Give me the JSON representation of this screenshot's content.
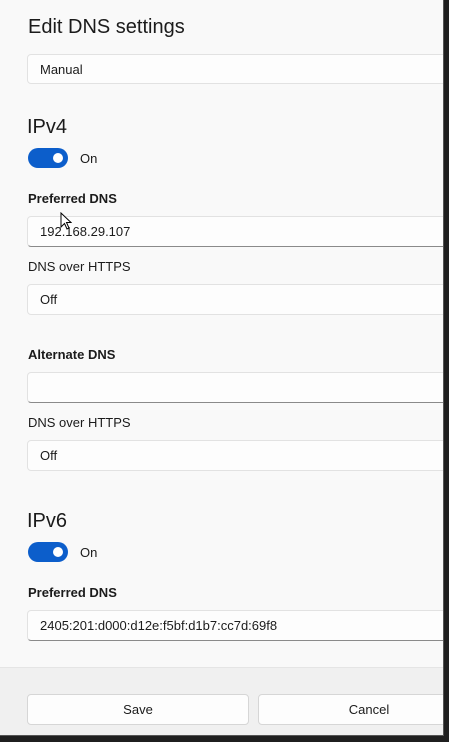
{
  "dialog": {
    "title": "Edit DNS settings",
    "mode_value": "Manual"
  },
  "ipv4": {
    "heading": "IPv4",
    "toggle_state": "On",
    "preferred_label": "Preferred DNS",
    "preferred_value": "192.168.29.107",
    "preferred_doh_label": "DNS over HTTPS",
    "preferred_doh_value": "Off",
    "alternate_label": "Alternate DNS",
    "alternate_value": "",
    "alternate_doh_label": "DNS over HTTPS",
    "alternate_doh_value": "Off"
  },
  "ipv6": {
    "heading": "IPv6",
    "toggle_state": "On",
    "preferred_label": "Preferred DNS",
    "preferred_value": "2405:201:d000:d12e:f5bf:d1b7:cc7d:69f8"
  },
  "footer": {
    "save_label": "Save",
    "cancel_label": "Cancel"
  },
  "colors": {
    "accent": "#0c5ecb",
    "dialog_bg": "#f9f9f9",
    "footer_bg": "#f0f0f0"
  },
  "icons": {
    "cursor": "mouse-pointer-icon"
  }
}
